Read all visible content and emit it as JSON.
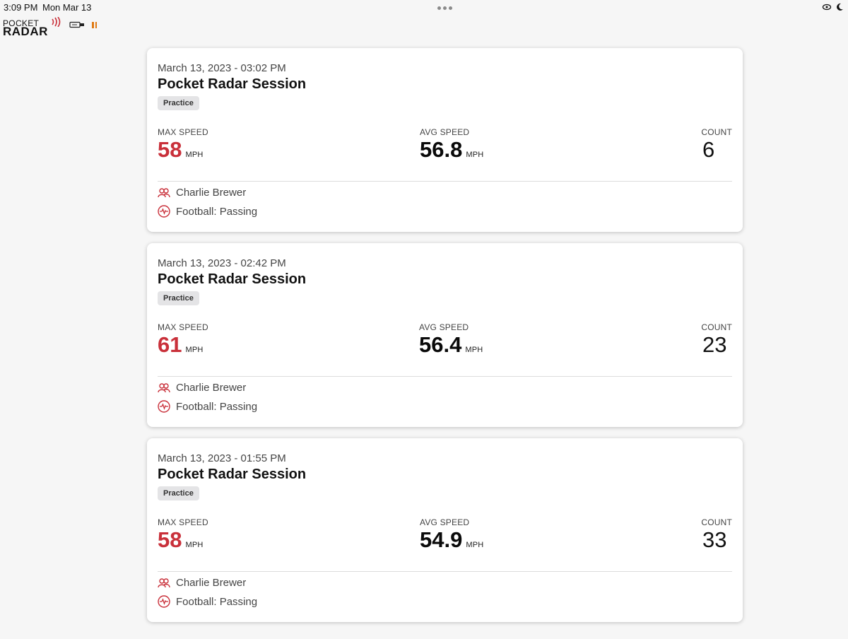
{
  "status_bar": {
    "time": "3:09 PM",
    "date": "Mon Mar 13",
    "icons": [
      "multitask-dots-icon",
      "screen-mirroring-icon",
      "do-not-disturb-moon-icon"
    ]
  },
  "app_header": {
    "logo_top": "POCKET",
    "logo_bottom": "RADAR",
    "icons": [
      "usb-connection-icon",
      "pause-icon"
    ],
    "brand_color": "#c9303a",
    "pause_color": "#e07a14"
  },
  "stat_labels": {
    "max": "MAX SPEED",
    "avg": "AVG SPEED",
    "count": "COUNT",
    "unit": "MPH"
  },
  "sessions": [
    {
      "date": "March 13, 2023 - 03:02 PM",
      "title": "Pocket Radar Session",
      "tag": "Practice",
      "max_speed": "58",
      "avg_speed": "56.8",
      "count": "6",
      "athlete": "Charlie Brewer",
      "activity": "Football: Passing"
    },
    {
      "date": "March 13, 2023 - 02:42 PM",
      "title": "Pocket Radar Session",
      "tag": "Practice",
      "max_speed": "61",
      "avg_speed": "56.4",
      "count": "23",
      "athlete": "Charlie Brewer",
      "activity": "Football: Passing"
    },
    {
      "date": "March 13, 2023 - 01:55 PM",
      "title": "Pocket Radar Session",
      "tag": "Practice",
      "max_speed": "58",
      "avg_speed": "54.9",
      "count": "33",
      "athlete": "Charlie Brewer",
      "activity": "Football: Passing"
    }
  ]
}
